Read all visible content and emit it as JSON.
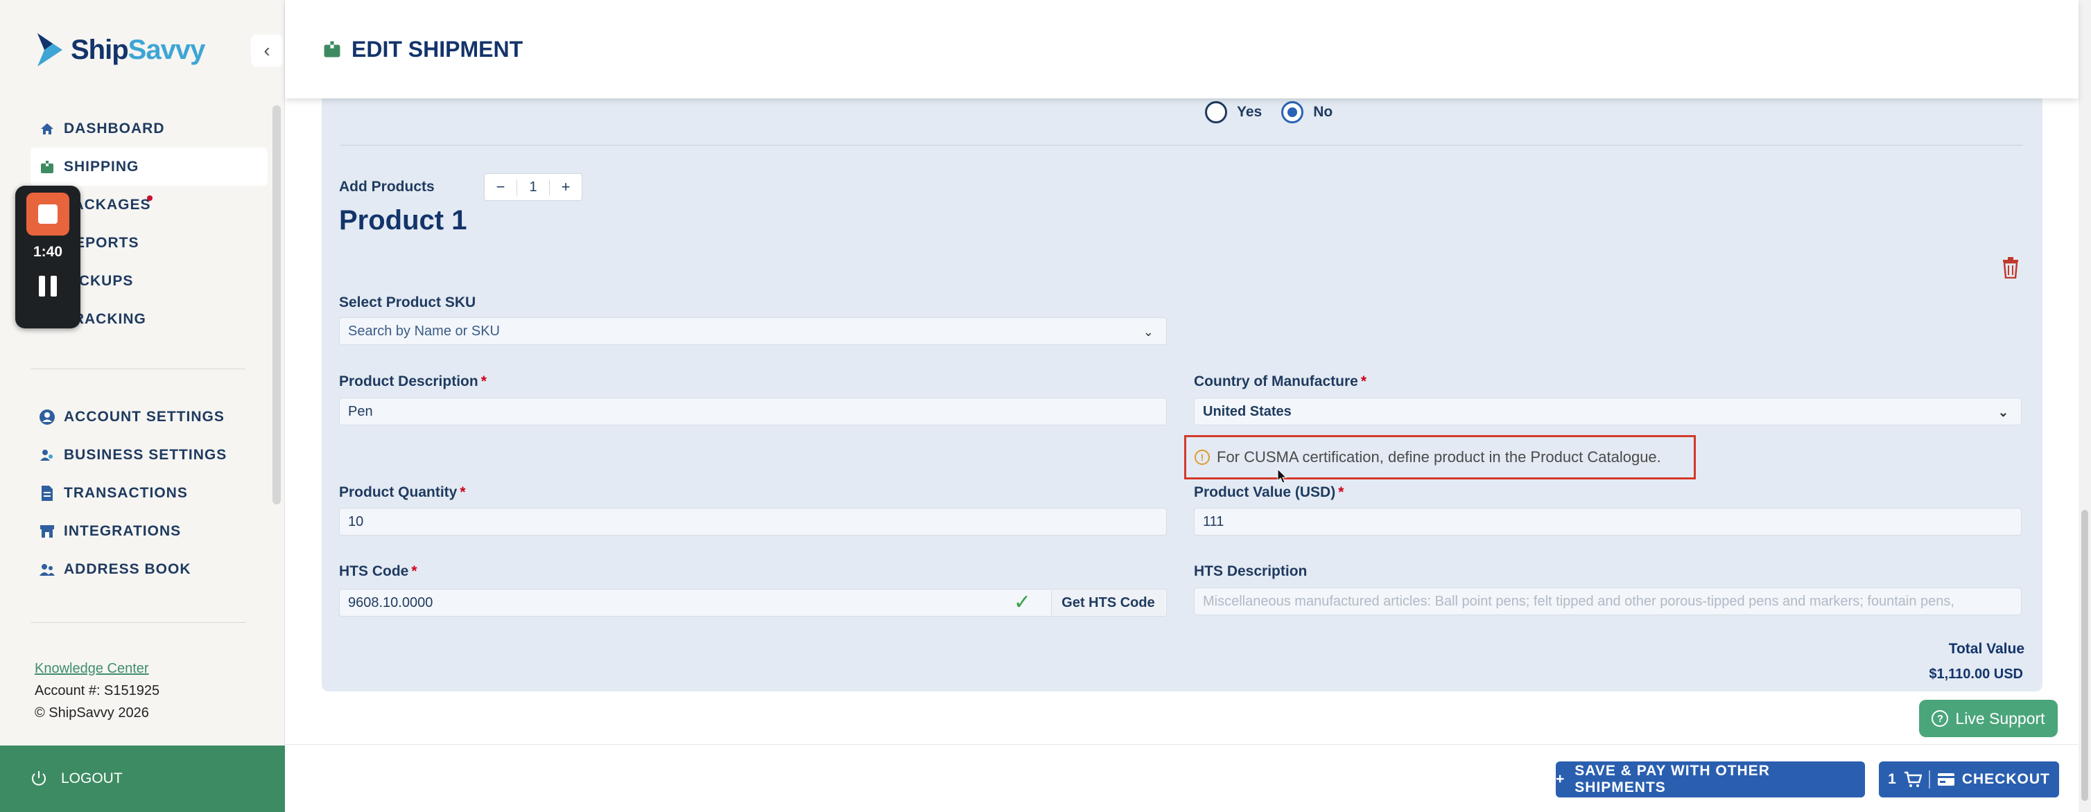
{
  "sidebar": {
    "logo": {
      "ship": "Ship",
      "savvy": "Savvy"
    },
    "nav_items": [
      {
        "label": "DASHBOARD",
        "icon": "home-icon"
      },
      {
        "label": "SHIPPING",
        "icon": "shipping-box-icon",
        "active": true
      },
      {
        "label": "PACKAGES",
        "icon": "package-icon",
        "has_alert_dot": true
      },
      {
        "label": "REPORTS",
        "icon": "reports-icon"
      },
      {
        "label": "PICKUPS",
        "icon": "pickups-icon"
      },
      {
        "label": "TRACKING",
        "icon": "tracking-icon"
      }
    ],
    "settings_items": [
      {
        "label": "ACCOUNT SETTINGS",
        "icon": "user-circle-icon"
      },
      {
        "label": "BUSINESS SETTINGS",
        "icon": "business-users-icon"
      },
      {
        "label": "TRANSACTIONS",
        "icon": "document-icon"
      },
      {
        "label": "INTEGRATIONS",
        "icon": "store-icon"
      },
      {
        "label": "ADDRESS BOOK",
        "icon": "contacts-icon"
      }
    ],
    "knowledge_center": "Knowledge Center",
    "account": "Account #: S151925",
    "copyright": "© ShipSavvy 2026",
    "logout": "LOGOUT"
  },
  "recorder": {
    "time": "1:40"
  },
  "header": {
    "title": "EDIT SHIPMENT"
  },
  "radio": {
    "yes": "Yes",
    "no": "No",
    "selected": "No"
  },
  "add_products": {
    "label": "Add Products",
    "minus": "−",
    "count": "1",
    "plus": "+"
  },
  "product": {
    "heading": "Product 1",
    "sku_label": "Select Product SKU",
    "sku_placeholder": "Search by Name or SKU",
    "description_label": "Product Description",
    "description_value": "Pen",
    "country_label": "Country of Manufacture",
    "country_value": "United States",
    "cusma_notice": "For CUSMA certification, define product in the Product Catalogue.",
    "quantity_label": "Product Quantity",
    "quantity_value": "10",
    "value_label": "Product Value (USD)",
    "value_value": "111",
    "hts_label": "HTS Code",
    "hts_value": "9608.10.0000",
    "hts_button": "Get HTS Code",
    "hts_desc_label": "HTS Description",
    "hts_desc_value": "Miscellaneous manufactured articles: Ball point pens; felt tipped and other porous-tipped pens and markers; fountain pens,",
    "required_mark": "*",
    "total_label": "Total Value",
    "total_value": "$1,110.00 USD"
  },
  "live_support": "Live Support",
  "footer": {
    "save_pay": "SAVE & PAY WITH OTHER SHIPMENTS",
    "save_plus": "+",
    "cart_count": "1",
    "checkout": "CHECKOUT"
  },
  "colors": {
    "brand_navy": "#13346b",
    "brand_blue": "#3ea5d5",
    "green": "#3d8b63",
    "button_blue": "#2a5fb0",
    "panel": "#e3eaf3",
    "alert_red": "#d23a2a"
  }
}
